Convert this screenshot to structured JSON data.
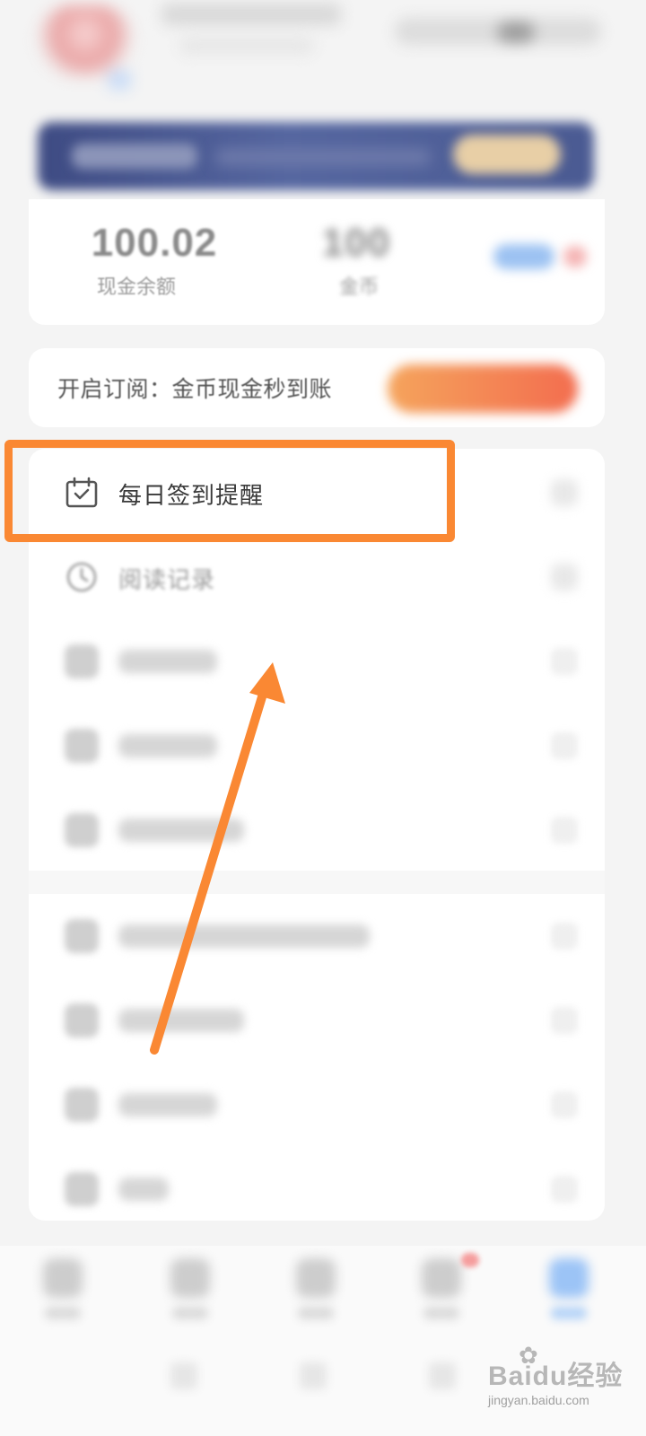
{
  "stats": {
    "cash_value": "100.02",
    "cash_label": "现金余额",
    "coin_value": "100",
    "coin_label": "金币"
  },
  "subscribe": {
    "text": "开启订阅：金币现金秒到账"
  },
  "menu": {
    "items": [
      {
        "label": "每日签到提醒",
        "icon": "calendar-check-icon",
        "highlighted": true
      },
      {
        "label": "阅读记录",
        "icon": "clock-icon",
        "highlighted": false
      }
    ]
  },
  "annotation": {
    "highlight_color": "#fa8833",
    "arrow_color": "#fa8833"
  },
  "watermark": {
    "brand": "Baidu经验",
    "url": "jingyan.baidu.com"
  },
  "colors": {
    "accent_orange": "#fa8833",
    "subscribe_gradient_start": "#f5a45c",
    "subscribe_gradient_end": "#f36d4f",
    "banner_bg": "#4a5a92",
    "page_bg": "#f4f4f4"
  }
}
